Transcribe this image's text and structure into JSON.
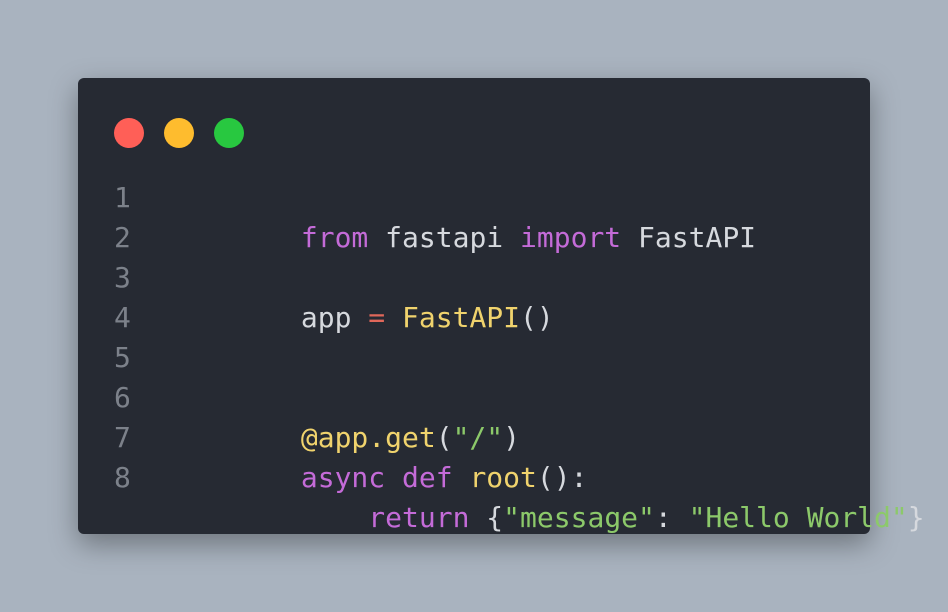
{
  "window": {
    "traffic_lights": [
      {
        "name": "close",
        "color": "#ff5f57"
      },
      {
        "name": "minimize",
        "color": "#febc2e"
      },
      {
        "name": "maximize",
        "color": "#28c840"
      }
    ]
  },
  "code": {
    "line_numbers": [
      "1",
      "2",
      "3",
      "4",
      "5",
      "6",
      "7",
      "8"
    ],
    "lines": [
      [
        {
          "text": "from",
          "cls": "kw"
        },
        {
          "text": " fastapi ",
          "cls": "plain"
        },
        {
          "text": "import",
          "cls": "kw"
        },
        {
          "text": " FastAPI",
          "cls": "plain"
        }
      ],
      [],
      [
        {
          "text": "app ",
          "cls": "plain"
        },
        {
          "text": "=",
          "cls": "op"
        },
        {
          "text": " ",
          "cls": "plain"
        },
        {
          "text": "FastAPI",
          "cls": "fn"
        },
        {
          "text": "()",
          "cls": "plain"
        }
      ],
      [],
      [],
      [
        {
          "text": "@app.get",
          "cls": "fn"
        },
        {
          "text": "(",
          "cls": "plain"
        },
        {
          "text": "\"/\"",
          "cls": "str"
        },
        {
          "text": ")",
          "cls": "plain"
        }
      ],
      [
        {
          "text": "async",
          "cls": "kw"
        },
        {
          "text": " ",
          "cls": "plain"
        },
        {
          "text": "def",
          "cls": "kw"
        },
        {
          "text": " ",
          "cls": "plain"
        },
        {
          "text": "root",
          "cls": "fn"
        },
        {
          "text": "():",
          "cls": "plain"
        }
      ],
      [
        {
          "text": "    ",
          "cls": "plain"
        },
        {
          "text": "return",
          "cls": "kw"
        },
        {
          "text": " {",
          "cls": "plain"
        },
        {
          "text": "\"message\"",
          "cls": "str"
        },
        {
          "text": ": ",
          "cls": "plain"
        },
        {
          "text": "\"Hello World\"",
          "cls": "str"
        },
        {
          "text": "}",
          "cls": "plain"
        }
      ]
    ]
  }
}
